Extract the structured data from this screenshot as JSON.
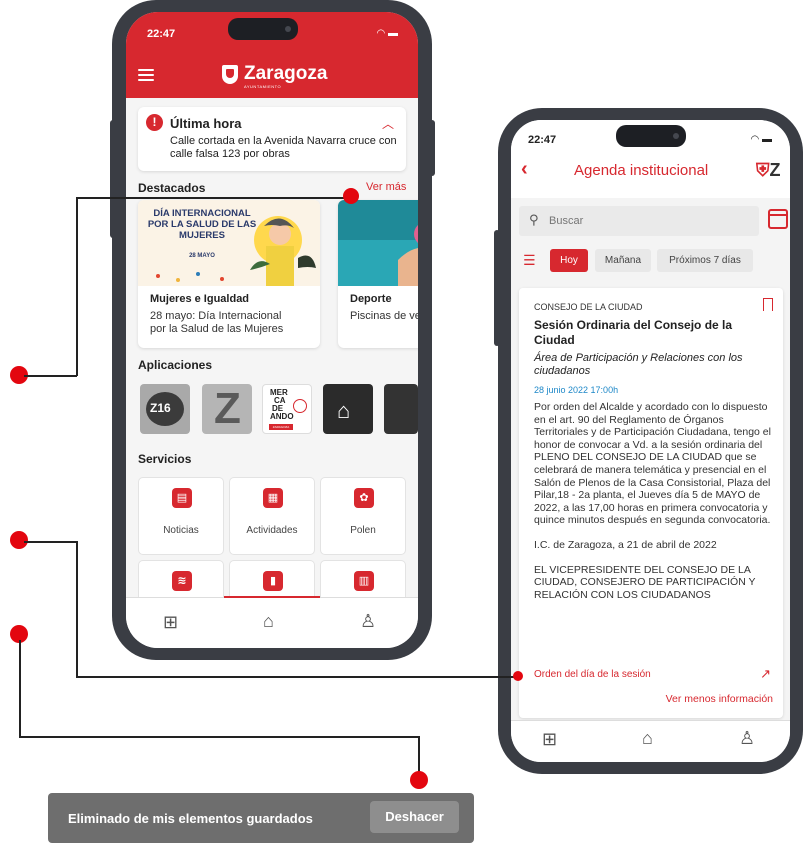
{
  "left_phone": {
    "status_time": "22:47",
    "header": {
      "brand": "Zaragoza",
      "brand_sub": "AYUNTAMIENTO"
    },
    "alert": {
      "title": "Última hora",
      "text": "Calle cortada en la Avenida Navarra cruce con calle falsa 123 por obras"
    },
    "featured": {
      "title": "Destacados",
      "see_more": "Ver más",
      "cards": [
        {
          "image_text": "DÍA INTERNACIONAL POR LA SALUD DE LAS MUJERES",
          "image_sub": "28 MAYO",
          "title": "Mujeres e Igualdad",
          "desc": "28 mayo: Día Internacional por la Salud de las Mujeres"
        },
        {
          "title": "Deporte",
          "desc": "Piscinas de ver"
        }
      ]
    },
    "apps": {
      "title": "Aplicaciones",
      "tiles": [
        "Z16",
        "Z",
        "MERCADEANDO",
        "",
        ""
      ],
      "mercadeando_lines": [
        "MER",
        "CA",
        "DE",
        "ANDO"
      ],
      "mercadeando_sub": "ZARAGOZA"
    },
    "services": {
      "title": "Servicios",
      "items": [
        {
          "label": "Noticias",
          "icon": "newspaper-icon"
        },
        {
          "label": "Actividades",
          "icon": "calendar-icon"
        },
        {
          "label": "Polen",
          "icon": "pollen-icon"
        },
        {
          "label": "",
          "icon": "wind-icon"
        },
        {
          "label": "",
          "icon": "book-icon"
        },
        {
          "label": "",
          "icon": "building-icon"
        }
      ]
    },
    "tabbar": [
      "grid-icon",
      "home-icon",
      "user-icon"
    ]
  },
  "right_phone": {
    "status_time": "22:47",
    "header": {
      "title": "Agenda institucional",
      "logo": "Z"
    },
    "search": {
      "placeholder": "Buscar"
    },
    "filters": [
      "Hoy",
      "Mañana",
      "Próximos 7 días"
    ],
    "event": {
      "category": "CONSEJO DE LA CIUDAD",
      "title": "Sesión Ordinaria del Consejo de la Ciudad",
      "area": "Área de Participación y Relaciones con los ciudadanos",
      "date": "28 junio 2022 17:00h",
      "body": [
        "Por orden del Alcalde y acordado con lo dispuesto en el art. 90 del Reglamento de Órganos Territoriales y de Participación Ciudadana, tengo el honor de convocar a Vd. a la sesión ordinaria del PLENO DEL CONSEJO DE LA CIUDAD que se celebrará de manera telemática y presencial en el Salón de Plenos de la Casa Consistorial, Plaza del Pilar,18 - 2a planta, el Jueves día 5 de MAYO de 2022, a las 17,00 horas en primera convocatoria y quince minutos después en segunda convocatoria.",
        "I.C. de Zaragoza, a 21 de abril de 2022",
        "EL VICEPRESIDENTE DEL CONSEJO DE LA CIUDAD, CONSEJERO DE PARTICIPACIÓN Y RELACIÓN CON LOS CIUDADANOS"
      ],
      "order_link": "Orden del día de la sesión",
      "less_info": "Ver menos información"
    },
    "tabbar": [
      "grid-icon",
      "home-icon",
      "user-icon"
    ]
  },
  "snackbar": {
    "message": "Eliminado de mis elementos guardados",
    "action": "Deshacer"
  },
  "colors": {
    "brand_red": "#d7282f",
    "callout_red": "#e3060f",
    "link_blue": "#1e88c8"
  }
}
